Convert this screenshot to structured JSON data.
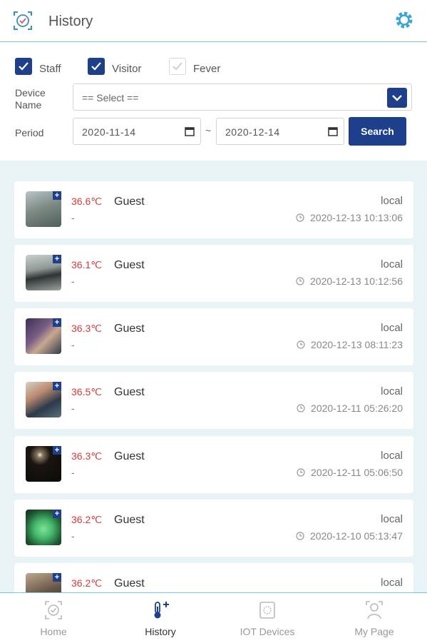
{
  "header": {
    "title": "History",
    "logo_icon": "face-scan-icon",
    "settings_icon": "gear-icon"
  },
  "filters": {
    "checkboxes": [
      {
        "label": "Staff",
        "checked": true
      },
      {
        "label": "Visitor",
        "checked": true
      },
      {
        "label": "Fever",
        "checked": false
      }
    ],
    "device_label_line1": "Device",
    "device_label_line2": "Name",
    "device_select_value": "== Select ==",
    "period_label": "Period",
    "date_from": "2020-11-14",
    "date_to": "2020-12-14",
    "range_separator": "~",
    "search_label": "Search"
  },
  "records": [
    {
      "temp": "36.6℃",
      "name": "Guest",
      "sub": "-",
      "source": "local",
      "time": "2020-12-13 10:13:06"
    },
    {
      "temp": "36.1℃",
      "name": "Guest",
      "sub": "-",
      "source": "local",
      "time": "2020-12-13 10:12:56"
    },
    {
      "temp": "36.3℃",
      "name": "Guest",
      "sub": "-",
      "source": "local",
      "time": "2020-12-13 08:11:23"
    },
    {
      "temp": "36.5℃",
      "name": "Guest",
      "sub": "-",
      "source": "local",
      "time": "2020-12-11 05:26:20"
    },
    {
      "temp": "36.3℃",
      "name": "Guest",
      "sub": "-",
      "source": "local",
      "time": "2020-12-11 05:06:50"
    },
    {
      "temp": "36.2℃",
      "name": "Guest",
      "sub": "-",
      "source": "local",
      "time": "2020-12-10 05:13:47"
    },
    {
      "temp": "36.2℃",
      "name": "Guest",
      "sub": "",
      "source": "local",
      "time": ""
    }
  ],
  "nav": [
    {
      "label": "Home",
      "icon": "home-face-icon",
      "active": false
    },
    {
      "label": "History",
      "icon": "thermometer-icon",
      "active": true
    },
    {
      "label": "IOT Devices",
      "icon": "device-icon",
      "active": false
    },
    {
      "label": "My Page",
      "icon": "user-icon",
      "active": false
    }
  ],
  "colors": {
    "accent": "#1d3f8c",
    "temp": "#d23b3b",
    "divider": "#7cc4de",
    "list_bg": "#e8f3f5"
  }
}
